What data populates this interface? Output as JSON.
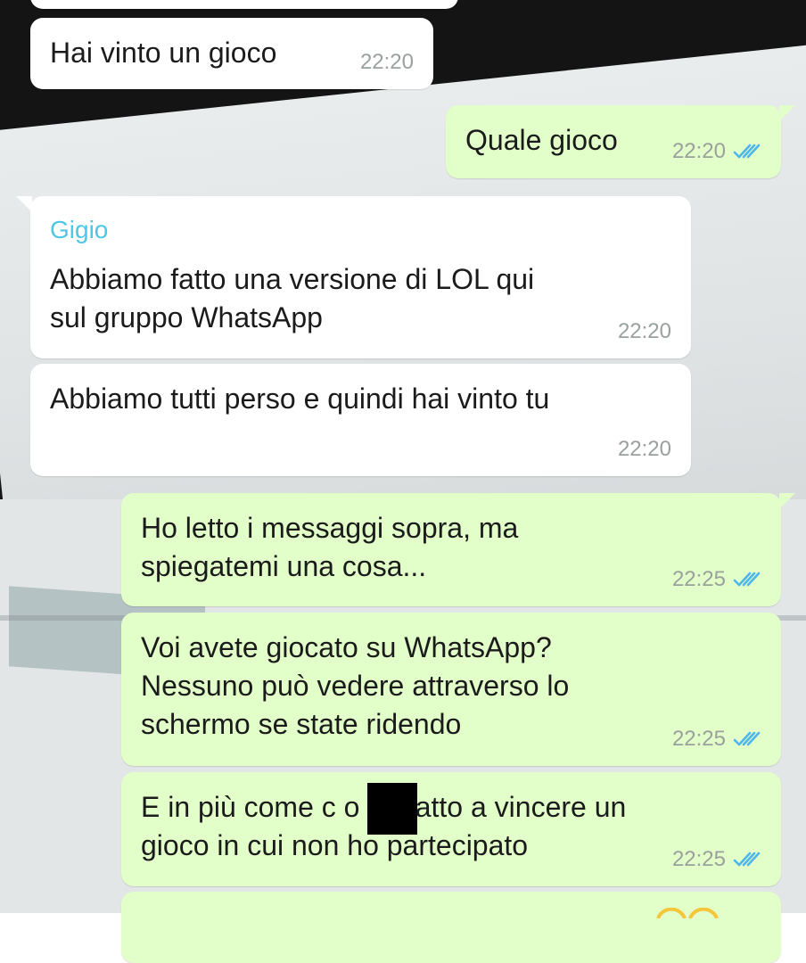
{
  "messages": [
    {
      "direction": "in",
      "text": "Hai vinto un gioco",
      "time": "22:20"
    },
    {
      "direction": "out",
      "text": "Quale gioco",
      "time": "22:20",
      "status_icon": "double-check-icon"
    },
    {
      "direction": "in",
      "sender": "Gigio",
      "text": "Abbiamo fatto una versione di LOL qui\nsul gruppo WhatsApp",
      "time": "22:20"
    },
    {
      "direction": "in",
      "text": "Abbiamo tutti perso e quindi hai vinto tu",
      "time": "22:20"
    },
    {
      "direction": "out",
      "text": "Ho letto i messaggi sopra, ma\nspiegatemi una cosa...",
      "time": "22:25",
      "status_icon": "double-check-icon"
    },
    {
      "direction": "out",
      "text": "Voi avete giocato su WhatsApp?\nNessuno può vedere attraverso lo\nschermo se state ridendo",
      "time": "22:25",
      "status_icon": "double-check-icon"
    },
    {
      "direction": "out",
      "text": "E in più come c       o ho fatto a vincere un\ngioco in cui non ho partecipato",
      "time": "22:25",
      "status_icon": "double-check-icon"
    }
  ],
  "colors": {
    "incoming_bubble": "#ffffff",
    "outgoing_bubble": "#e2fec9",
    "sender_name": "#4dc7e6",
    "read_check": "#4fb6ec"
  }
}
